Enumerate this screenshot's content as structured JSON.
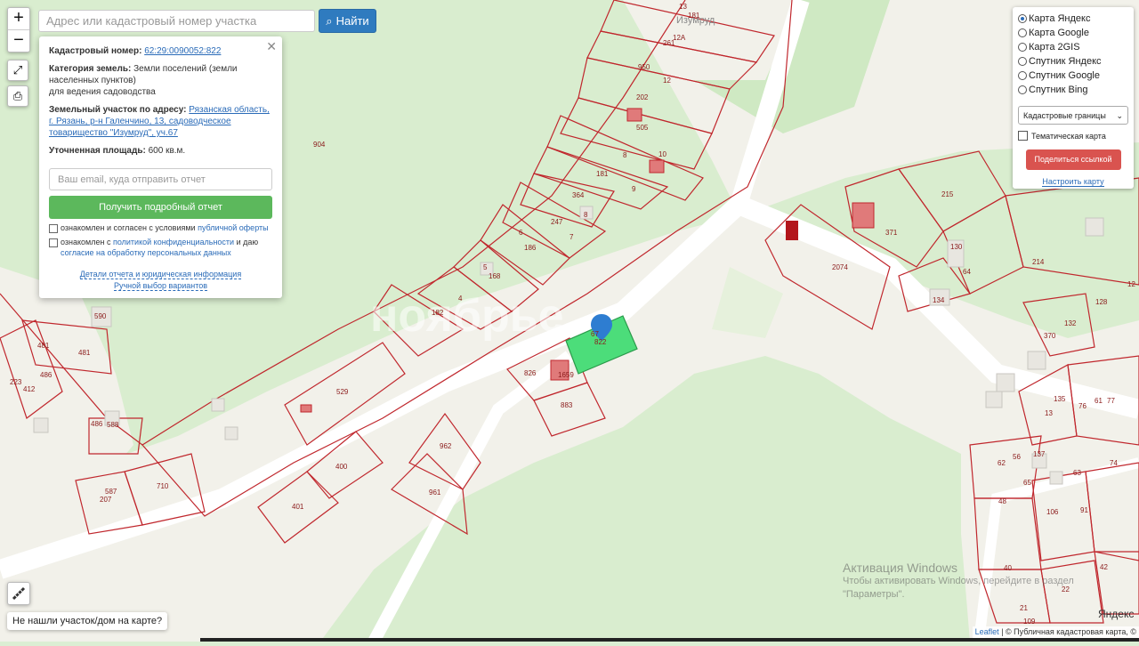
{
  "search": {
    "placeholder": "Адрес или кадастровый номер участка",
    "button_label": "Найти"
  },
  "zoom": {
    "in_label": "+",
    "out_label": "−"
  },
  "popup": {
    "cadastral_label": "Кадастровый номер:",
    "cadastral_value": "62:29:0090052:822",
    "category_label": "Категория земель:",
    "category_value": "Земли поселений (земли населенных пунктов)",
    "usage_value": "для ведения садоводства",
    "address_label": "Земельный участок по адресу:",
    "address_value": "Рязанская область, г. Рязань, р-н Галенчино, 13, садоводческое товарищество \"Изумруд\", уч.67",
    "area_label": "Уточненная площадь:",
    "area_value": "600 кв.м.",
    "email_placeholder": "Ваш email, куда отправить отчет",
    "report_button": "Получить подробный отчет",
    "agree1_text": "ознакомлен и согласен с условиями ",
    "agree1_link": "публичной оферты",
    "agree2_text": "ознакомлен с ",
    "agree2_link1": "политикой конфиденциальности",
    "agree2_mid": " и даю ",
    "agree2_link2": "согласие на обработку персональных данных",
    "details_link": "Детали отчета и юридическая информация",
    "manual_link": "Ручной выбор вариантов"
  },
  "layers": {
    "options": [
      "Карта Яндекс",
      "Карта Google",
      "Карта 2GIS",
      "Спутник Яндекс",
      "Спутник Google",
      "Спутник Bing"
    ],
    "selected_index": 0,
    "select_value": "Кадастровые границы",
    "thematic_label": "Тематическая карта",
    "share_button": "Поделиться ссылкой",
    "configure_link": "Настроить карту"
  },
  "not_found_button": "Не нашли участок/дом на карте?",
  "attribution": {
    "leaflet": "Leaflet",
    "rest": " | © Публичная кадастровая карта, ©"
  },
  "windows": {
    "title": "Активация Windows",
    "line1": "Чтобы активировать Windows, перейдите в раздел",
    "line2": "\"Параметры\"."
  },
  "watermark": "ноябрье.",
  "map_labels": [
    "13",
    "181",
    "Изумруд",
    "12А",
    "261",
    "950",
    "12",
    "202",
    "505",
    "8",
    "10",
    "181",
    "9",
    "364",
    "8",
    "247",
    "7",
    "6",
    "186",
    "5",
    "168",
    "4",
    "182",
    "904",
    "590",
    "481",
    "481",
    "486",
    "223",
    "412",
    "486",
    "588",
    "529",
    "587",
    "207",
    "710",
    "400",
    "401",
    "962",
    "961",
    "826",
    "822",
    "67",
    "1659",
    "883",
    "215",
    "2074",
    "371",
    "130",
    "64",
    "214",
    "134",
    "132",
    "128",
    "12",
    "370",
    "135",
    "76",
    "61",
    "77",
    "13",
    "74",
    "62",
    "56",
    "137",
    "65",
    "63",
    "48",
    "106",
    "91",
    "40",
    "42",
    "22",
    "21",
    "109",
    "Яндекс"
  ],
  "colors": {
    "accent": "#2f7bbf",
    "green_button": "#5cb85c",
    "red_button": "#d9534f",
    "parcel_line": "#c0272d",
    "selected_parcel": "#4cdd7a"
  }
}
